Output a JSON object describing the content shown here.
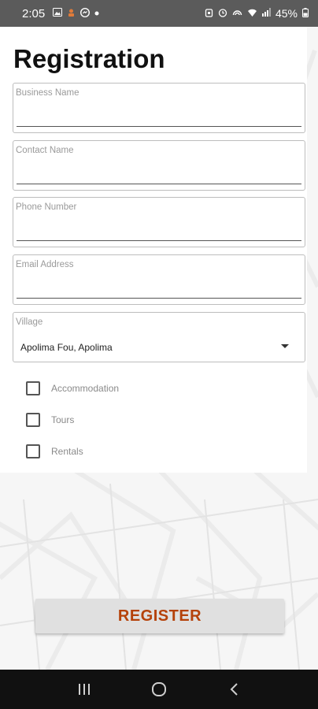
{
  "status_bar": {
    "time": "2:05",
    "battery": "45%",
    "left_icons": [
      "gallery-icon",
      "app-notification-icon",
      "messenger-icon",
      "dot-icon"
    ],
    "right_icons": [
      "alarm-icon",
      "clock-icon",
      "hotspot-icon",
      "wifi-icon",
      "signal-icon",
      "battery-icon"
    ]
  },
  "page": {
    "title": "Registration"
  },
  "form": {
    "business_name": {
      "label": "Business Name",
      "value": ""
    },
    "contact_name": {
      "label": "Contact Name",
      "value": ""
    },
    "phone_number": {
      "label": "Phone Number",
      "value": ""
    },
    "email_address": {
      "label": "Email Address",
      "value": ""
    },
    "village": {
      "label": "Village",
      "value": "Apolima Fou, Apolima"
    },
    "checkboxes": [
      {
        "label": "Accommodation",
        "checked": false
      },
      {
        "label": "Tours",
        "checked": false
      },
      {
        "label": "Rentals",
        "checked": false
      }
    ]
  },
  "register_button": {
    "label": "REGISTER"
  },
  "colors": {
    "accent": "#b5420a",
    "status_bar": "#5b5b5b",
    "nav_bar": "#111111"
  },
  "nav_bar": {
    "icons": [
      "recent-apps-icon",
      "home-icon",
      "back-icon"
    ]
  }
}
